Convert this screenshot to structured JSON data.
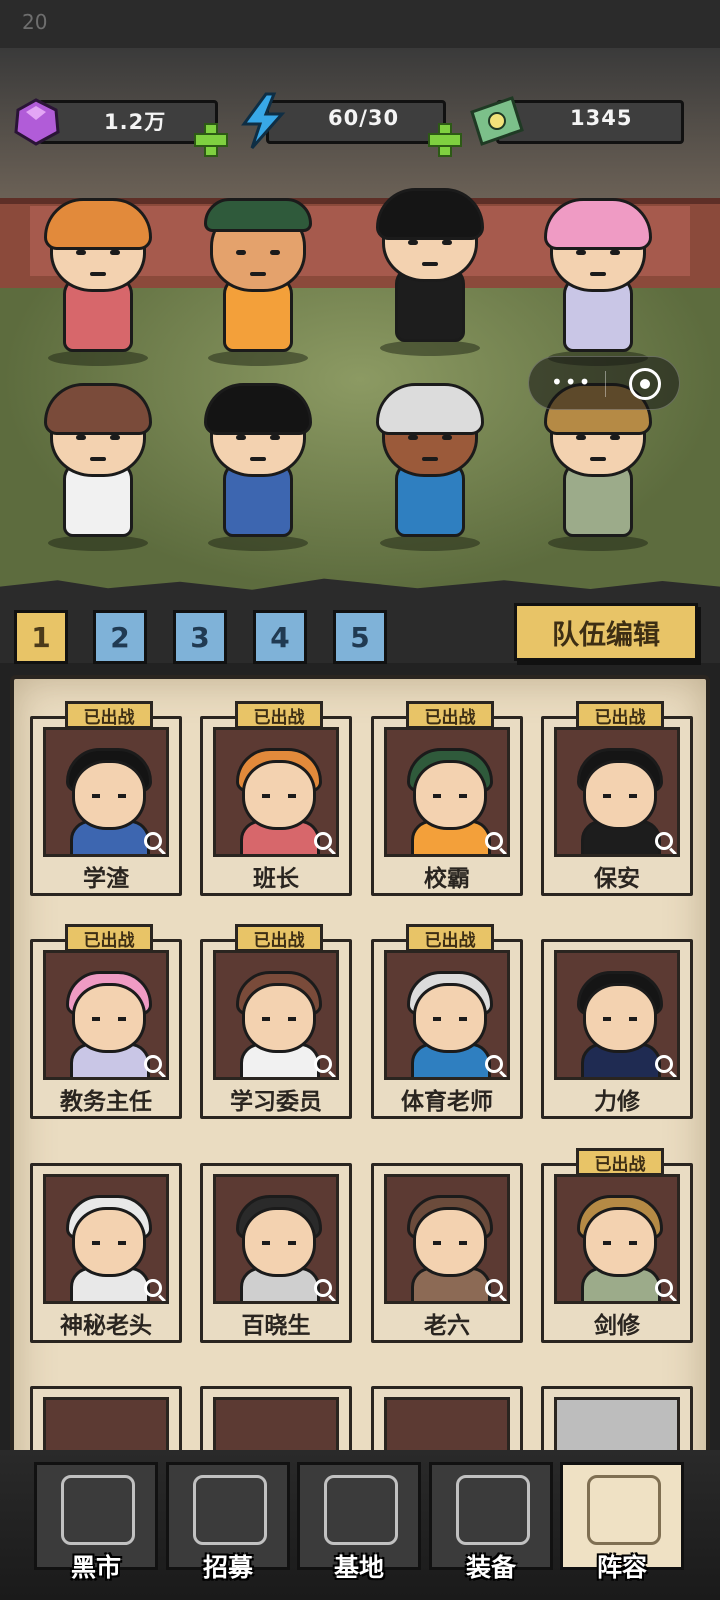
{
  "status_bar": {
    "time": "20"
  },
  "resources": {
    "gems": "1.2万",
    "energy": "60/30",
    "cash": "1345"
  },
  "colors": {
    "gem": "#b15cd8",
    "energy": "#38a8e8",
    "cash": "#7cc08a",
    "plus": "#7fd040",
    "tab_active": "#e8c467",
    "tab_idle": "#7fb2d8",
    "badge": "#e8c467"
  },
  "team_tabs": [
    "1",
    "2",
    "3",
    "4",
    "5"
  ],
  "active_team_tab": "1",
  "team_edit_label": "队伍编辑",
  "deployed_badge": "已出战",
  "roster": [
    {
      "name": "学渣",
      "deployed": true,
      "icon": "spiky-hair-student"
    },
    {
      "name": "班长",
      "deployed": true,
      "icon": "hamster-hood-girl"
    },
    {
      "name": "校霸",
      "deployed": true,
      "icon": "bully-boy"
    },
    {
      "name": "保安",
      "deployed": true,
      "icon": "rocker-guard"
    },
    {
      "name": "教务主任",
      "deployed": true,
      "icon": "pink-hair-director"
    },
    {
      "name": "学习委员",
      "deployed": true,
      "icon": "glasses-girl"
    },
    {
      "name": "体育老师",
      "deployed": true,
      "icon": "cat-ear-coach"
    },
    {
      "name": "力修",
      "deployed": false,
      "icon": "suit-man"
    },
    {
      "name": "神秘老头",
      "deployed": false,
      "icon": "white-hair-elder"
    },
    {
      "name": "百晓生",
      "deployed": false,
      "icon": "scholar"
    },
    {
      "name": "老六",
      "deployed": false,
      "icon": "boar"
    },
    {
      "name": "剑修",
      "deployed": true,
      "icon": "sword-cultivator"
    }
  ],
  "nav": [
    {
      "label": "黑市",
      "icon": "bag-icon"
    },
    {
      "label": "招募",
      "icon": "cards-icon"
    },
    {
      "label": "基地",
      "icon": "castle-icon"
    },
    {
      "label": "装备",
      "icon": "gear-items-icon"
    },
    {
      "label": "阵容",
      "icon": "lineup-icon"
    }
  ],
  "active_nav": "阵容"
}
